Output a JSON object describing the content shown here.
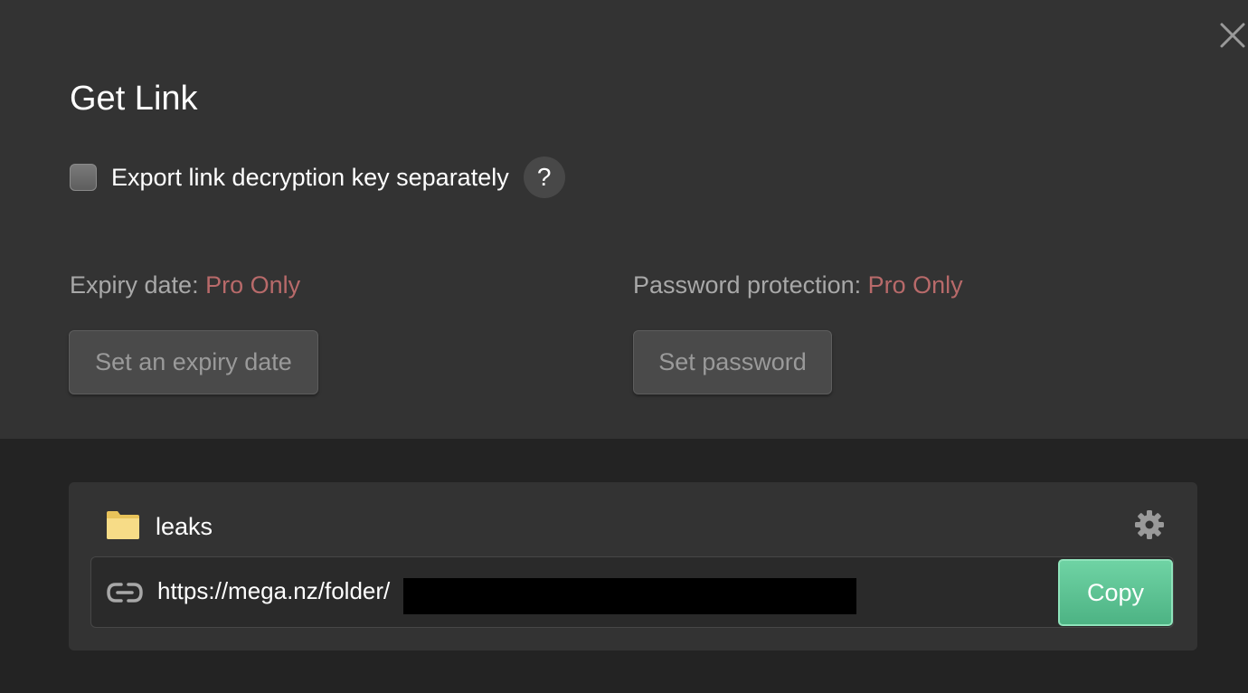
{
  "dialog": {
    "title": "Get Link"
  },
  "export_option": {
    "checkbox_label": "Export link decryption key separately",
    "checked": false,
    "help_label": "?"
  },
  "expiry": {
    "label": "Expiry date:",
    "badge": "Pro Only",
    "button_label": "Set an expiry date"
  },
  "password": {
    "label": "Password protection:",
    "badge": "Pro Only",
    "button_label": "Set password"
  },
  "link": {
    "folder_name": "leaks",
    "url": "https://mega.nz/folder/",
    "copy_label": "Copy"
  },
  "colors": {
    "accent_green": "#5cc293",
    "pro_only_red": "#b86a6a",
    "folder_yellow": "#f5d77b"
  },
  "icons": {
    "close": "close-icon",
    "help": "question-icon",
    "folder": "folder-icon",
    "settings": "gear-icon",
    "link": "link-icon"
  }
}
